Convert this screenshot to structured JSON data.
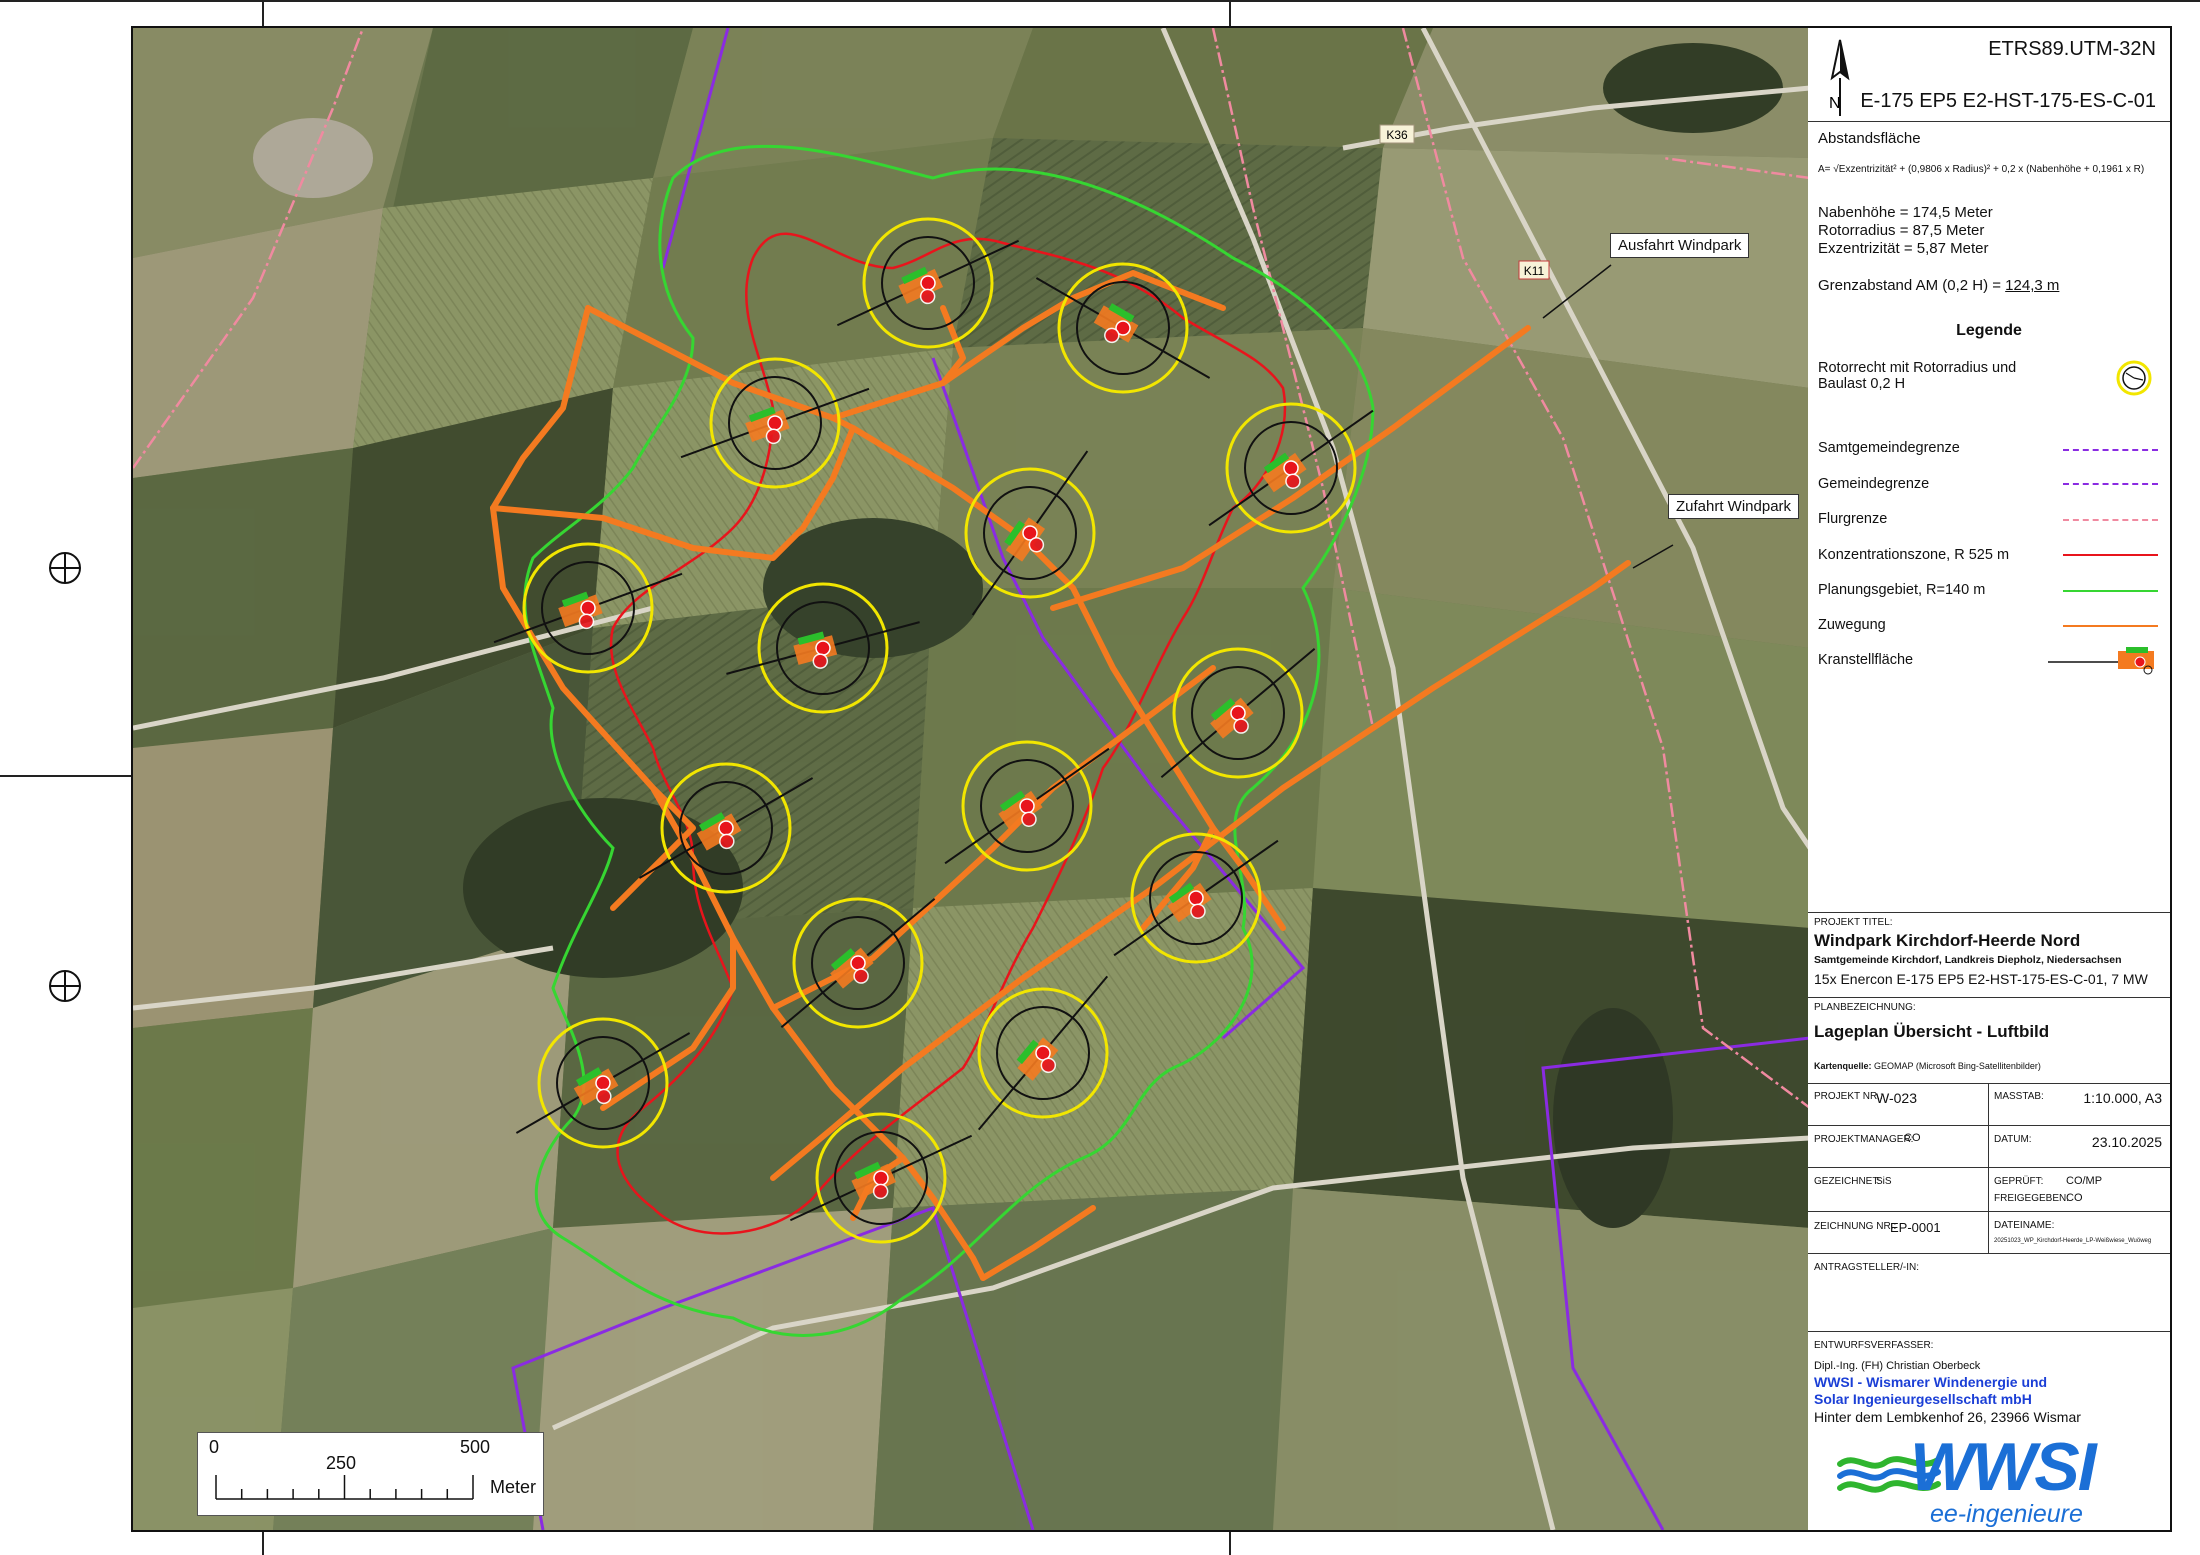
{
  "map": {
    "crs": "ETRS89.UTM-32N",
    "turbine_type": "E-175 EP5 E2-HST-175-ES-C-01",
    "callouts": {
      "exit": "Ausfahrt Windpark",
      "access": "Zufahrt Windpark"
    },
    "road_labels": [
      "K36",
      "K11"
    ],
    "scale": {
      "ticks": [
        "0",
        "250",
        "500"
      ],
      "unit": "Meter"
    }
  },
  "distance": {
    "heading": "Abstandsfläche",
    "formula": "A= √Exzentrizität² + (0,9806 x Radius)² + 0,2 x (Nabenhöhe + 0,1961 x R)",
    "hub_height": "Nabenhöhe = 174,5   Meter",
    "rotor_radius": "Rotorradius = 87,5   Meter",
    "eccentricity": "Exzentrizität = 5,87  Meter",
    "limit_label": "Grenzabstand AM (0,2 H) = ",
    "limit_value": "124,3 m"
  },
  "legend": {
    "title": "Legende",
    "items": [
      {
        "label": "Rotorrecht mit Rotorradius und Baulast 0,2 H",
        "color": "#f2e600",
        "style": "circle"
      },
      {
        "label": "Samtgemeindegrenze",
        "color": "#8a2be2",
        "style": "dash-dot"
      },
      {
        "label": "Gemeindegrenze",
        "color": "#8a2be2",
        "style": "dash-dot"
      },
      {
        "label": "Flurgrenze",
        "color": "#f08aa0",
        "style": "dash-dot"
      },
      {
        "label": "Konzentrationszone, R 525 m",
        "color": "#e8141c",
        "style": "solid"
      },
      {
        "label": "Planungsgebiet, R=140 m",
        "color": "#36d632",
        "style": "solid"
      },
      {
        "label": "Zuwegung",
        "color": "#f47a20",
        "style": "solid"
      },
      {
        "label": "Kranstellfläche",
        "color": "#f47a20",
        "style": "pad"
      }
    ]
  },
  "title_block": {
    "project_title_label": "PROJEKT TITEL:",
    "project_name": "Windpark Kirchdorf-Heerde Nord",
    "project_location": "Samtgemeinde Kirchdorf, Landkreis Diepholz, Niedersachsen",
    "project_config": "15x Enercon E-175 EP5 E2-HST-175-ES-C-01, 7 MW",
    "plan_label": "PLANBEZEICHNUNG:",
    "plan_name": "Lageplan Übersicht - Luftbild",
    "source_label": "Kartenquelle:",
    "source_value": "GEOMAP (Microsoft Bing-Satellitenbilder)",
    "project_nr_label": "PROJEKT NR.:",
    "project_nr": "W-023",
    "scale_label": "MASSTAB:",
    "scale": "1:10.000, A3",
    "manager_label": "PROJEKTMANAGER:",
    "manager": "CO",
    "date_label": "DATUM:",
    "date": "23.10.2025",
    "drawn_label": "GEZEICHNET:",
    "drawn": "SiS",
    "checked_label": "GEPRÜFT:",
    "checked": "CO/MP",
    "released_label": "FREIGEGEBEN:",
    "released": "CO",
    "drawing_nr_label": "ZEICHNUNG NR.:",
    "drawing_nr": "EP-0001",
    "filename_label": "DATEINAME:",
    "filename": "20251023_WP_Kirchdorf-Heerde_LP-Weißwiese_Wuöweg",
    "applicant_label": "ANTRAGSTELLER/-IN:",
    "author_label": "ENTWURFSVERFASSER:",
    "author_person": "Dipl.-Ing. (FH) Christian Oberbeck",
    "author_company_1": "WWSI - Wismarer Windenergie und",
    "author_company_2": "Solar Ingenieurgesellschaft mbH",
    "author_address": "Hinter dem Lembkenhof 26, 23966 Wismar",
    "logo_text": "WWSI",
    "logo_sub": "ee-ingenieure"
  }
}
